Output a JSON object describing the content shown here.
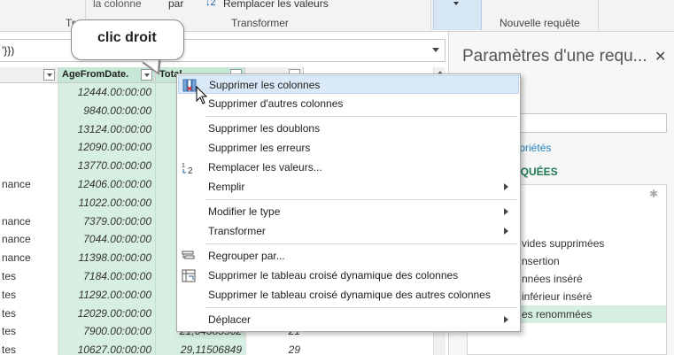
{
  "ribbon": {
    "col_label": "la colonne",
    "par_label": "par",
    "replace_label": "Remplacer les valeurs",
    "group_left": "Tr",
    "group_transform": "Transformer",
    "group_new_query": "Nouvelle requête"
  },
  "formula": {
    "text": "'}})"
  },
  "grid": {
    "headers": [
      "",
      "AgeFromDate.",
      "Total...",
      ""
    ],
    "col_a": [
      "",
      "",
      "",
      "",
      "",
      "nance",
      "",
      "nance",
      "nance",
      "nance",
      "tes",
      "tes",
      "tes",
      "tes",
      "tes"
    ],
    "col_b": [
      "12444.00:00:00",
      "9840.00:00:00",
      "13124.00:00:00",
      "12090.00:00:00",
      "13770.00:00:00",
      "12406.00:00:00",
      "11022.00:00:00",
      "7379.00:00:00",
      "7044.00:00:00",
      "11398.00:00:00",
      "7184.00:00:00",
      "11292.00:00:00",
      "12029.00:00:00",
      "7900.00:00:00",
      "10627.00:00:00"
    ],
    "col_c": [
      "",
      "",
      "",
      "",
      "",
      "",
      "",
      "",
      "",
      "",
      "",
      "",
      "",
      "21,64383562",
      "29,11506849"
    ],
    "col_d": [
      "",
      "",
      "",
      "",
      "",
      "",
      "",
      "",
      "",
      "",
      "",
      "",
      "",
      "21",
      "29"
    ]
  },
  "pane": {
    "title": "Paramètres d'une requ...",
    "close": "✕",
    "properties_heading": "ÉS",
    "properties_link": "propriétés",
    "steps_heading": "PLIQUÉES",
    "steps": [
      "vides supprimées",
      "nsertion",
      "nnées inséré",
      "inférieur inséré",
      "es renommées"
    ]
  },
  "callout": {
    "text": "clic droit"
  },
  "menu": {
    "items": [
      {
        "label": "Supprimer les colonnes",
        "icon": "remove-columns-icon",
        "hover": true,
        "submenu": false
      },
      {
        "label": "Supprimer d'autres colonnes",
        "submenu": false
      },
      {
        "label": "Supprimer les doublons",
        "submenu": false
      },
      {
        "label": "Supprimer les erreurs",
        "submenu": false
      },
      {
        "label": "Remplacer les valeurs...",
        "icon": "replace-values-icon",
        "submenu": false
      },
      {
        "label": "Remplir",
        "submenu": true
      },
      {
        "label": "Modifier le type",
        "submenu": true
      },
      {
        "label": "Transformer",
        "submenu": true
      },
      {
        "label": "Regrouper par...",
        "icon": "group-by-icon",
        "submenu": false
      },
      {
        "label": "Supprimer le tableau croisé dynamique des colonnes",
        "icon": "unpivot-icon",
        "submenu": false
      },
      {
        "label": "Supprimer le tableau croisé dynamique des autres colonnes",
        "submenu": false
      },
      {
        "label": "Déplacer",
        "submenu": true
      }
    ]
  },
  "colors": {
    "selected_column": "#d7eee2",
    "menu_hover": "#d9e9f7",
    "link": "#1e7fbc",
    "heading_green": "#1f7b52"
  }
}
